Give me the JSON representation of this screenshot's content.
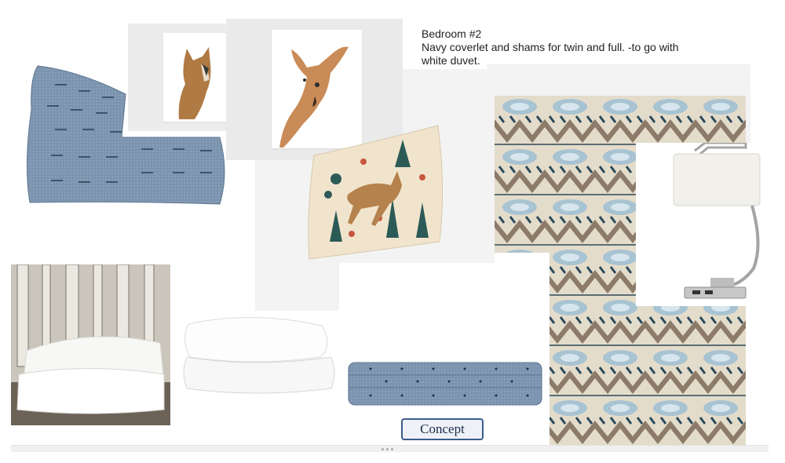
{
  "board": {
    "note": {
      "title": "Bedroom #2",
      "body": "Navy coverlet and shams for twin and full. -to go with white duvet."
    },
    "concept_button": {
      "label": "Concept"
    },
    "colors": {
      "navy_accent": "#3a5d8c",
      "chambray_blue": "#7e96b1",
      "panel_gray": "#f3f3f4"
    },
    "images": [
      "blue-pillow-image",
      "fox-print-image",
      "fawn-print-image",
      "deer-folk-pillow-image",
      "ikat-rug-image",
      "table-lamp-image",
      "birch-tree-duvet-image",
      "white-duvet-image",
      "blue-coverlet-image"
    ]
  }
}
